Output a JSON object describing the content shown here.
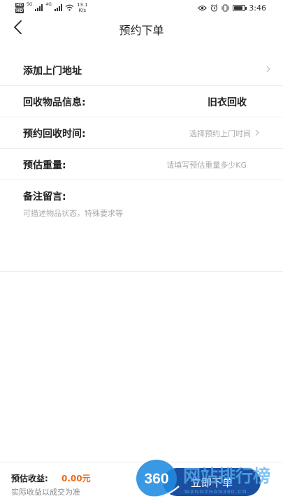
{
  "status_bar": {
    "hd": "HD",
    "network": "4G",
    "network2": "5G",
    "speed_value": "13.1",
    "speed_unit": "K/s",
    "time": "3:46",
    "battery_level": 0.85
  },
  "header": {
    "title": "预约下单",
    "back_icon": "chevron-left-icon"
  },
  "form": {
    "address_label": "添加上门地址",
    "item_info_label": "回收物品信息:",
    "item_info_value": "旧衣回收",
    "time_label": "预约回收时间:",
    "time_placeholder": "选择预约上门时间",
    "weight_label": "预估重量:",
    "weight_placeholder": "请填写预估重量多少KG",
    "remark_label": "备注留言:",
    "remark_placeholder": "可描述物品状态，特殊要求等"
  },
  "footer": {
    "income_label": "预估收益:",
    "income_value": "0.00元",
    "income_note": "实际收益以成交为准",
    "submit_label": "立即下单"
  },
  "watermark": {
    "brand_number": "360",
    "brand_text": "网站排行榜",
    "brand_url": "WANGZHAN360.CN"
  },
  "colors": {
    "accent": "#f06a1a",
    "button": "#1a4fa0",
    "muted": "#aaaaaa"
  }
}
